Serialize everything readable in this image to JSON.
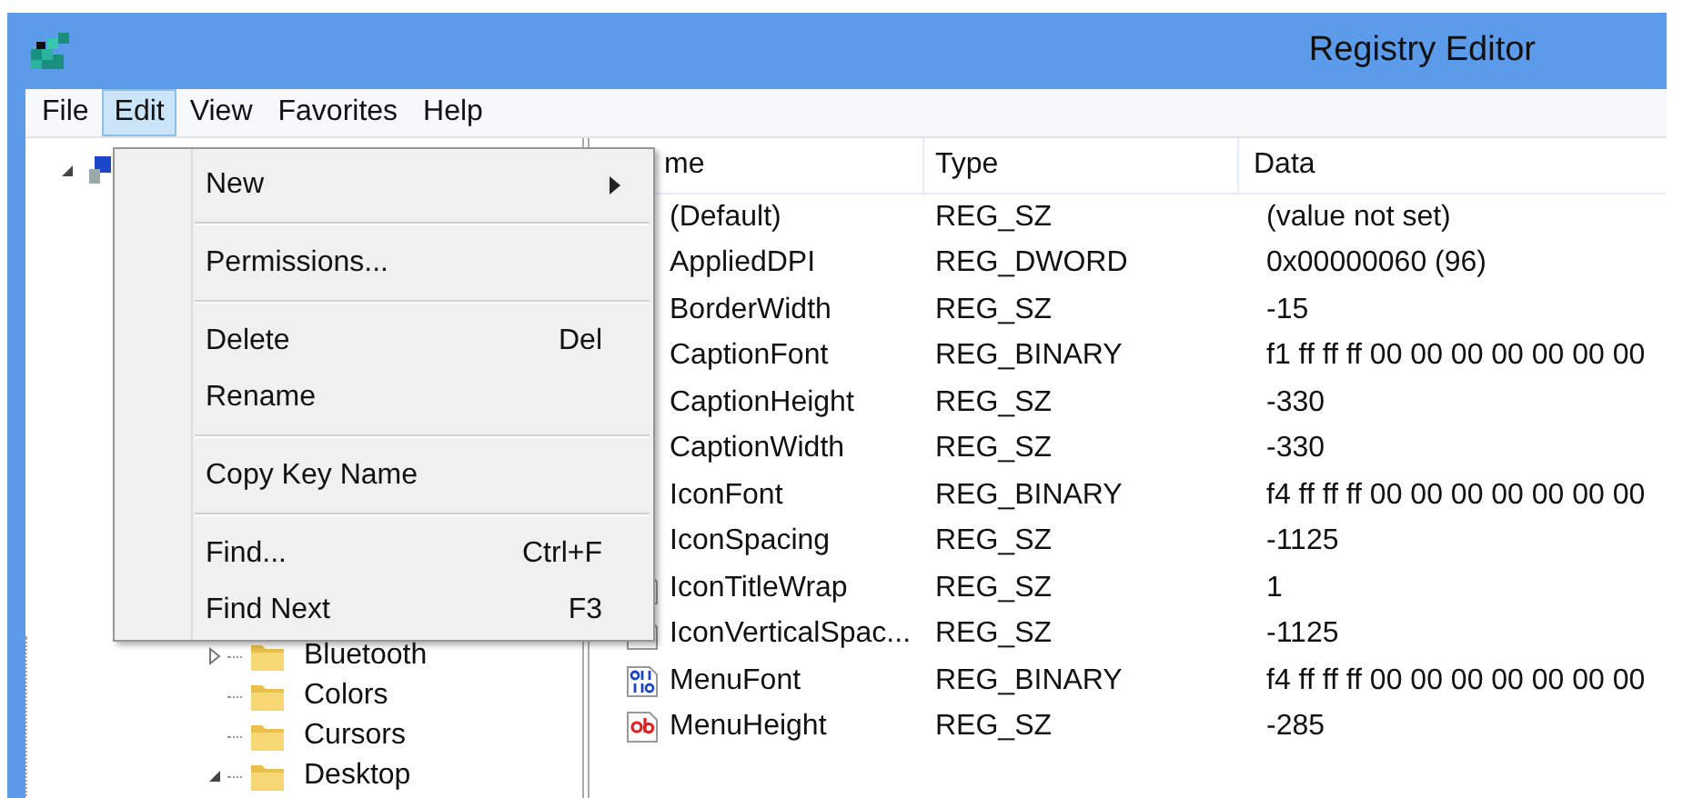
{
  "window": {
    "title": "Registry Editor"
  },
  "menu_bar": [
    {
      "label": "File",
      "selected": false
    },
    {
      "label": "Edit",
      "selected": true
    },
    {
      "label": "View",
      "selected": false
    },
    {
      "label": "Favorites",
      "selected": false
    },
    {
      "label": "Help",
      "selected": false
    }
  ],
  "edit_menu": {
    "items": [
      {
        "kind": "item",
        "label": "New",
        "submenu": true
      },
      {
        "kind": "separator"
      },
      {
        "kind": "item",
        "label": "Permissions...",
        "submenu": false
      },
      {
        "kind": "separator"
      },
      {
        "kind": "item",
        "label": "Delete",
        "shortcut": "Del",
        "submenu": false
      },
      {
        "kind": "item",
        "label": "Rename",
        "submenu": false
      },
      {
        "kind": "separator"
      },
      {
        "kind": "item",
        "label": "Copy Key Name",
        "submenu": false
      },
      {
        "kind": "separator"
      },
      {
        "kind": "item",
        "label": "Find...",
        "shortcut": "Ctrl+F",
        "submenu": false
      },
      {
        "kind": "item",
        "label": "Find Next",
        "shortcut": "F3",
        "submenu": false
      }
    ]
  },
  "tree": {
    "root": {
      "expanded": true
    },
    "items": [
      {
        "label": "Bluetooth",
        "has_children": true,
        "expanded": false
      },
      {
        "label": "Colors",
        "has_children": false
      },
      {
        "label": "Cursors",
        "has_children": false
      },
      {
        "label": "Desktop",
        "has_children": true,
        "expanded": true
      }
    ]
  },
  "list": {
    "columns": [
      "me",
      "Type",
      "Data"
    ],
    "rows": [
      {
        "name": "(Default)",
        "type": "REG_SZ",
        "data": "(value not set)"
      },
      {
        "name": "AppliedDPI",
        "type": "REG_DWORD",
        "data": "0x00000060 (96)"
      },
      {
        "name": "BorderWidth",
        "type": "REG_SZ",
        "data": "-15"
      },
      {
        "name": "CaptionFont",
        "type": "REG_BINARY",
        "data": "f1 ff ff ff 00 00 00 00 00 00 00"
      },
      {
        "name": "CaptionHeight",
        "type": "REG_SZ",
        "data": "-330"
      },
      {
        "name": "CaptionWidth",
        "type": "REG_SZ",
        "data": "-330"
      },
      {
        "name": "IconFont",
        "type": "REG_BINARY",
        "data": "f4 ff ff ff 00 00 00 00 00 00 00"
      },
      {
        "name": "IconSpacing",
        "type": "REG_SZ",
        "data": "-1125"
      },
      {
        "name": "IconTitleWrap",
        "type": "REG_SZ",
        "data": "1",
        "kind": "string"
      },
      {
        "name": "IconVerticalSpac...",
        "type": "REG_SZ",
        "data": "-1125",
        "kind": "string"
      },
      {
        "name": "MenuFont",
        "type": "REG_BINARY",
        "data": "f4 ff ff ff 00 00 00 00 00 00 00",
        "kind": "binary"
      },
      {
        "name": "MenuHeight",
        "type": "REG_SZ",
        "data": "-285",
        "kind": "string"
      }
    ]
  }
}
